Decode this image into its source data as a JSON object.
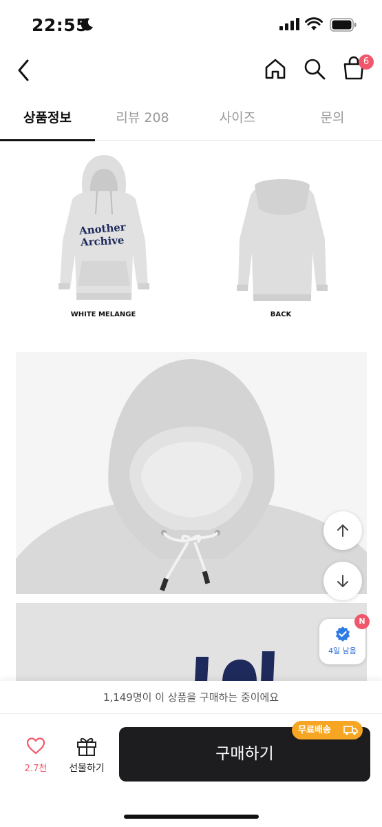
{
  "status_bar": {
    "time": "22:55"
  },
  "header": {
    "cart_count": "6"
  },
  "tabs": [
    {
      "label": "상품정보"
    },
    {
      "label": "리뷰 208"
    },
    {
      "label": "사이즈"
    },
    {
      "label": "문의"
    }
  ],
  "product_images": {
    "logo_line1": "Another",
    "logo_line2": "Archive",
    "front_caption": "WHITE MELANGE",
    "back_caption": "BACK"
  },
  "coupon": {
    "badge": "N",
    "label": "4일 남음"
  },
  "purchase_notice": "1,149명이 이 상품을 구매하는 중이에요",
  "actions": {
    "like_count": "2.7천",
    "gift_label": "선물하기",
    "buy_label": "구매하기",
    "shipping_badge": "무료배송"
  },
  "colors": {
    "accent": "#f0576b",
    "buy_bg": "#1d1d1f",
    "shipping": "#f6a623",
    "logo_navy": "#1f2a5c"
  }
}
